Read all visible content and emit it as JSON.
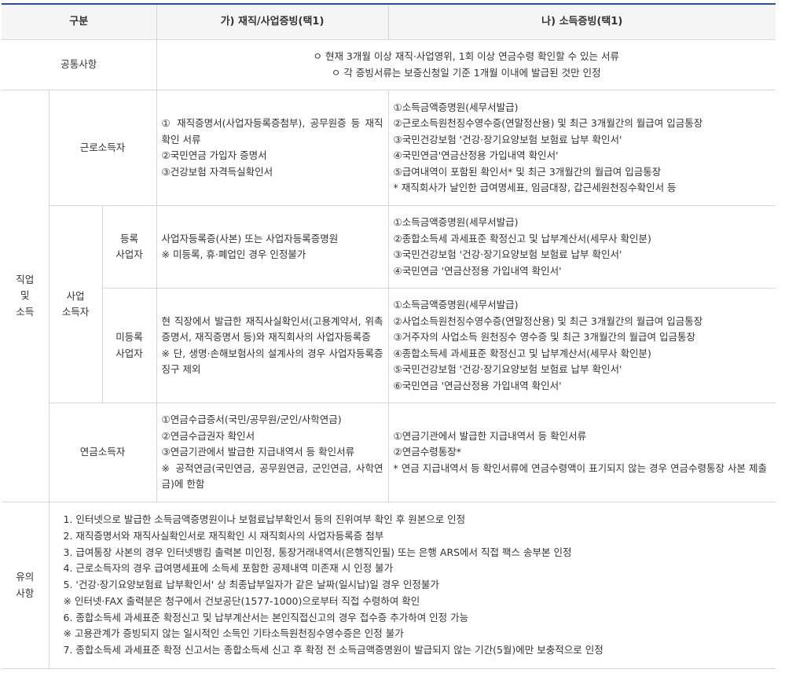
{
  "header": {
    "col1": "구분",
    "col2": "가) 재직/사업증빙(택1)",
    "col3": "나) 소득증빙(택1)"
  },
  "common": {
    "label": "공통사항",
    "lines": [
      "ㅇ 현재 3개월 이상 재직·사업영위, 1회 이상 연금수령 확인할 수 있는 서류",
      "ㅇ 각 증빙서류는 보증신청일 기준 1개월 이내에 발급된 것만 인정"
    ]
  },
  "job_income": {
    "label": "직업\n및\n소득",
    "worker": {
      "label": "근로소득자",
      "employment": [
        "① 재직증명서(사업자등록증첨부), 공무원증 등 재직확인 서류",
        "②국민연금 가입자 증명서",
        "③건강보험 자격득실확인서"
      ],
      "income": [
        "①소득금액증명원(세무서발급)",
        "②근로소득원천징수영수증(연말정산용) 및 최근 3개월간의 월급여 입금통장",
        "③국민건강보험 '건강·장기요양보험 보험료 납부 확인서'",
        "④국민연금'연금산정용 가입내역 확인서'",
        "⑤급여내역이 포함된 확인서* 및 최근 3개월간의 월급여 입금통장",
        "* 재직회사가 날인한 급여명세표, 임금대장, 갑근세원천징수확인서 등"
      ]
    },
    "business": {
      "label": "사업\n소득자",
      "registered": {
        "label": "등록\n사업자",
        "employment": [
          "사업자등록증(사본) 또는 사업자등록증명원",
          "※ 미등록, 휴·폐업인 경우 인정불가"
        ],
        "income": [
          "①소득금액증명원(세무서발급)",
          "②종합소득세 과세표준 확정신고 및 납부계산서(세무사 확인분)",
          "③국민건강보험 '건강·장기요양보험 보험료 납부 확인서'",
          "④국민연금 '연금산정용 가입내역 확인서'"
        ]
      },
      "unregistered": {
        "label": "미등록\n사업자",
        "employment": [
          "현 직장에서 발급한 재직사실확인서(고용계약서, 위촉증명서, 재직증명서 등)와 재직회사의 사업자등록증",
          "※ 단, 생명·손해보험사의 설계사의 경우 사업자등록증 징구 제외"
        ],
        "income": [
          "①소득금액증명원(세무서발급)",
          "②사업소득원천징수영수증(연말정산용) 및 최근 3개월간의 월급여 입금통장",
          "③거주자의 사업소득 원천징수 영수증 및 최근 3개월간의 월급여 입금통장",
          "④종합소득세 과세표준 확정신고 및 납부계산서(세무사 확인분)",
          "⑤국민건강보험 '건강·장기요양보험 보험료 납부 확인서'",
          "⑥국민연금 '연금산정용 가입내역 확인서'"
        ]
      }
    },
    "pension": {
      "label": "연금소득자",
      "employment": [
        "①연금수급증서(국민/공무원/군인/사학연금)",
        "②연금수급권자 확인서",
        "③연금기관에서 발급한 지급내역서 등 확인서류",
        "※ 공적연금(국민연금, 공무원연금, 군인연금, 사학연금)에 한함"
      ],
      "income": [
        "①연금기관에서 발급한 지급내역서 등 확인서류",
        "②연금수령통장*",
        "* 연금 지급내역서 등 확인서류에 연금수령액이 표기되지 않는 경우 연금수령통장 사본 제출"
      ]
    }
  },
  "notes": {
    "label": "유의\n사항",
    "items": [
      "1. 인터넷으로 발급한 소득금액증명원이나 보험료납부확인서 등의 진위여부 확인 후 원본으로 인정",
      "2. 재직증명서와 재직사실확인서로 재직확인 시 재직회사의 사업자등록증 첨부",
      "3. 급여통장 사본의 경우 인터넷뱅킹 출력본 미인정, 통장거래내역서(은행직인필) 또는 은행 ARS에서 직접 팩스 송부본 인정",
      "4. 근로소득자의 경우 급여명세표에 소득세 포함한 공제내역 미존재 시 인정 불가",
      "5. '건강·장기요양보험료 납부확인서' 상 최종납부일자가 같은 날짜(일시납)일 경우 인정불가",
      "※ 인터넷·FAX 출력분은 청구에서 건보공단(1577-1000)으로부터 직접 수령하여 확인",
      "6. 종합소득세 과세표준 확정신고 및 납부계산서는 본인직접신고의 경우 접수증 추가하여 인정 가능",
      "※ 고용관계가 증빙되지 않는 일시적인 소득인 기타소득원천징수영수증은 인정 불가",
      "7. 종합소득세 과세표준 확정 신고서는 종합소득세 신고 후 확정 전 소득금액증명원이 발급되지 않는 기간(5월)에만 보충적으로 인정"
    ]
  }
}
